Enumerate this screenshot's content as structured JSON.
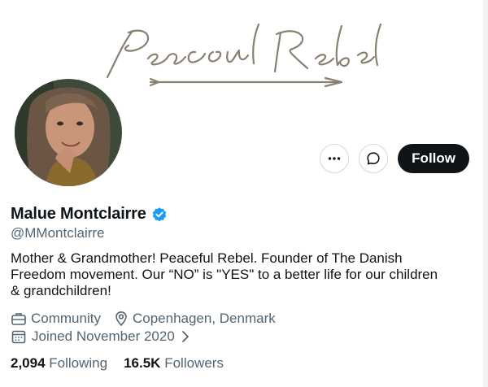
{
  "banner": {
    "logo_text": "Peaceful Rebel"
  },
  "actions": {
    "more_icon": "more-horizontal-icon",
    "message_icon": "message-bubble-icon",
    "follow_label": "Follow"
  },
  "profile": {
    "name": "Malue Montclairre",
    "handle": "@MMontclairre",
    "verified_color": "#1d9bf0",
    "bio": "Mother & Grandmother! Peaceful Rebel. Founder of The Danish Freedom movement. Our “NO” is \"YES\" to a better life for our children & grandchildren!",
    "category": "Community",
    "location": "Copenhagen, Denmark",
    "joined": "Joined November 2020"
  },
  "stats": {
    "following_count": "2,094",
    "following_label": "Following",
    "followers_count": "16.5K",
    "followers_label": "Followers"
  },
  "colors": {
    "text": "#0f1419",
    "secondary": "#536471",
    "accent": "#1d9bf0",
    "border": "#cfd9de"
  }
}
